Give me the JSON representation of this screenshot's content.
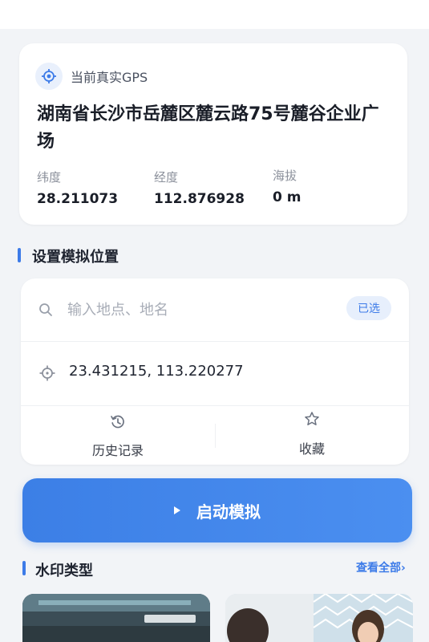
{
  "current_gps": {
    "label": "当前真实GPS",
    "address": "湖南省长沙市岳麓区麓云路75号麓谷企业广场",
    "latitude": {
      "key": "纬度",
      "value": "28.211073"
    },
    "longitude": {
      "key": "经度",
      "value": "112.876928"
    },
    "altitude": {
      "key": "海拔",
      "value": "0 m"
    }
  },
  "simulate": {
    "section_title": "设置模拟位置",
    "search_placeholder": "输入地点、地名",
    "search_value": "",
    "selected_badge": "已选",
    "coordinates": "23.431215, 113.220277",
    "history_label": "历史记录",
    "favorite_label": "收藏"
  },
  "start_button": {
    "label": "启动模拟"
  },
  "watermark": {
    "section_title": "水印类型",
    "view_all": "查看全部›"
  },
  "colors": {
    "accent": "#3d7be8",
    "background": "#f2f4f7",
    "card": "#ffffff"
  }
}
